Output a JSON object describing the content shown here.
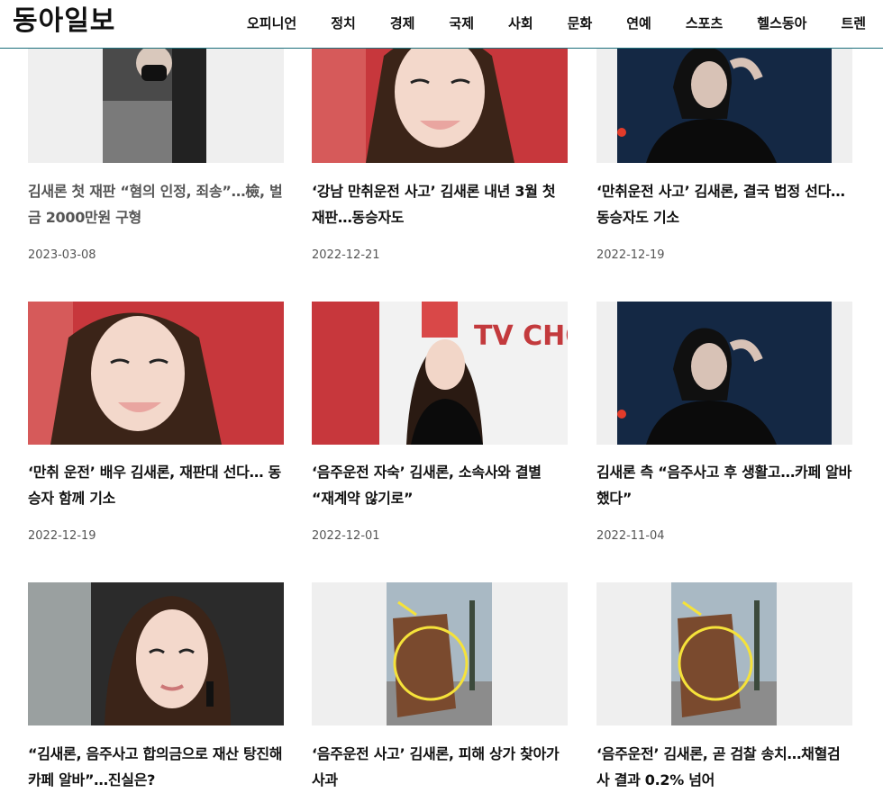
{
  "header": {
    "logo": "동아일보",
    "nav": [
      "오피니언",
      "정치",
      "경제",
      "국제",
      "사회",
      "문화",
      "연예",
      "스포츠",
      "헬스동아",
      "트렌"
    ]
  },
  "articles": [
    {
      "title": "김새론 첫 재판 “혐의 인정, 죄송”…檢, 벌금 2000만원 구형",
      "date": "2023-03-08",
      "thumb": "mask-icon"
    },
    {
      "title": "‘강남 만취운전 사고’ 김새론 내년 3월 첫 재판…동승자도",
      "date": "2022-12-21",
      "thumb": "portrait-red-backdrop"
    },
    {
      "title": "‘만취운전 사고’ 김새론, 결국 법정 선다…동승자도 기소",
      "date": "2022-12-19",
      "thumb": "portrait-night"
    },
    {
      "title": "‘만취 운전’ 배우 김새론, 재판대 선다… 동승자 함께 기소",
      "date": "2022-12-19",
      "thumb": "portrait-red-backdrop"
    },
    {
      "title": "‘음주운전 자숙’ 김새론, 소속사와 결별 “재계약 않기로”",
      "date": "2022-12-01",
      "thumb": "portrait-tv-chosun",
      "logo_text": "TV CHOSU"
    },
    {
      "title": "김새론 측 “음주사고 후 생활고…카페 알바했다”",
      "date": "2022-11-04",
      "thumb": "portrait-night"
    },
    {
      "title": "“김새론, 음주사고 합의금으로 재산 탕진해 카페 알바”…진실은?",
      "date": "",
      "thumb": "portrait-earrings"
    },
    {
      "title": "‘음주운전 사고’ 김새론, 피해 상가 찾아가 사과",
      "date": "",
      "thumb": "fence-circle"
    },
    {
      "title": "‘음주운전’ 김새론, 곧 검찰 송치…채혈검사 결과 0.2% 넘어",
      "date": "",
      "thumb": "fence-circle"
    }
  ]
}
